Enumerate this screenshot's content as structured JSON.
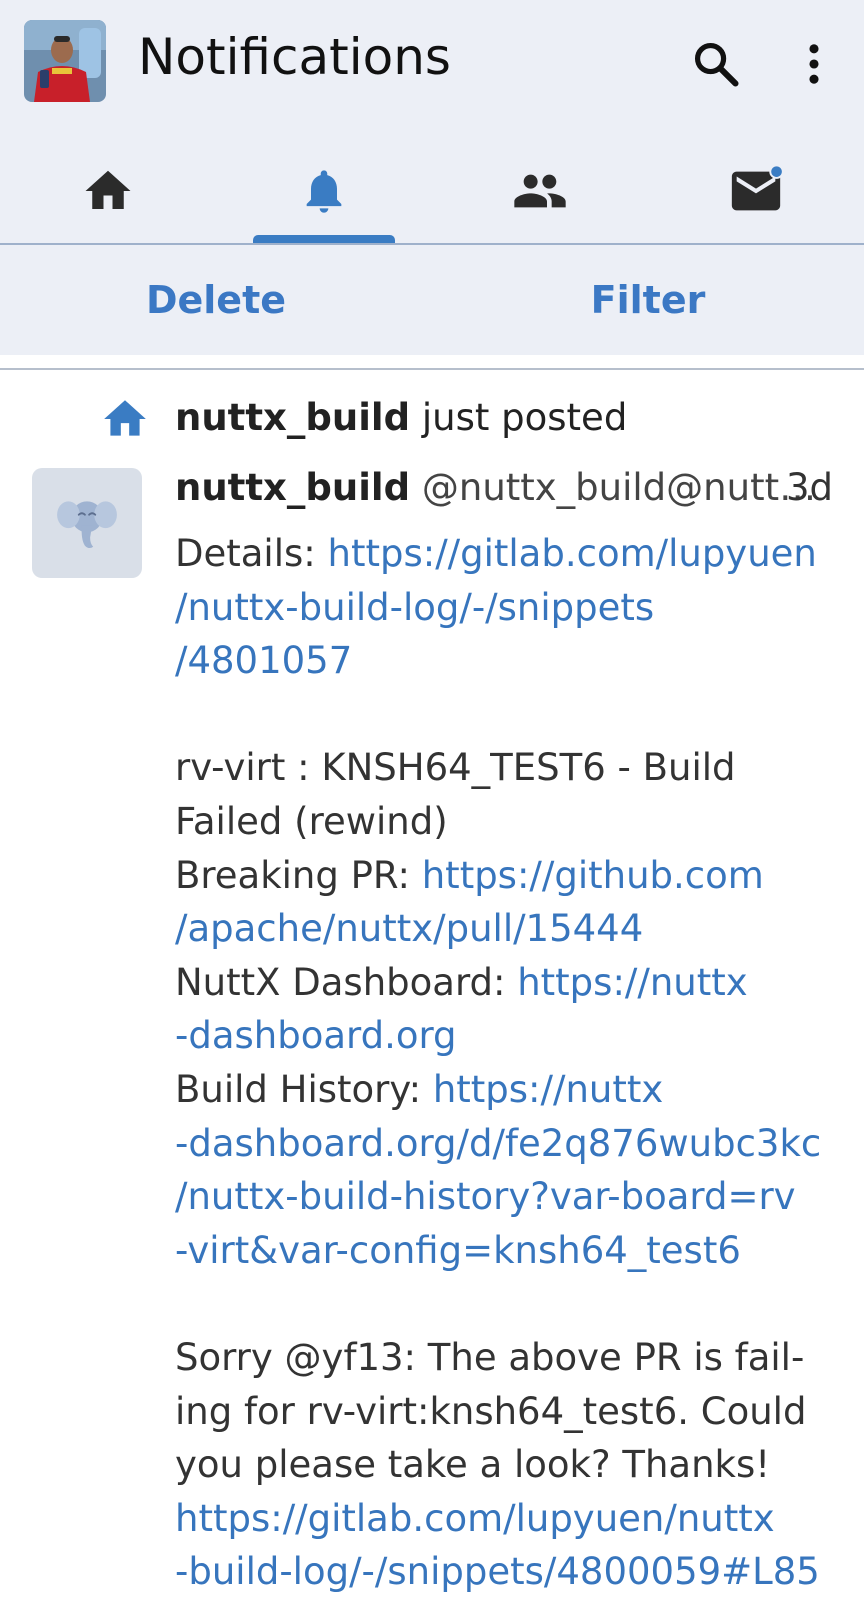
{
  "header": {
    "title": "Notifications",
    "avatar": "profile-photo",
    "search_icon": "search-icon",
    "more_icon": "more-vert-icon"
  },
  "tabs": [
    {
      "name": "home",
      "icon": "home-icon",
      "active": false
    },
    {
      "name": "notifications",
      "icon": "bell-icon",
      "active": true
    },
    {
      "name": "people",
      "icon": "people-icon",
      "active": false
    },
    {
      "name": "messages",
      "icon": "mail-icon",
      "active": false,
      "badge": true
    }
  ],
  "actions": {
    "delete_label": "Delete",
    "filter_label": "Filter"
  },
  "notification": {
    "icon": "home-icon",
    "actor": "nuttx_build",
    "verb": "just posted",
    "status": {
      "display_name": "nuttx_build",
      "handle": "@nuttx_build@nutt…",
      "time": "3d",
      "lines": {
        "l1_text": "Details: ",
        "l1_link": "https://gitlab.com/lupyuen",
        "l2_link": "/nuttx-build-log/-/snippets",
        "l3_link": "/4801057",
        "l4_text": "rv-virt : KNSH64_TEST6 - Build",
        "l5_text": "Failed (rewind)",
        "l6_text": "Breaking PR: ",
        "l6_link": "https://github.com",
        "l7_link": "/apache/nuttx/pull/15444",
        "l8_text": "NuttX Dashboard: ",
        "l8_link": "https://nuttx",
        "l9_link": "-dashboard.org",
        "l10_text": "Build History: ",
        "l10_link": "https://nuttx",
        "l11_link": "-dashboard.org/d/fe2q876wubc3kc",
        "l12_link": "/nuttx-build-history?var-board=rv",
        "l13_link": "-virt&var-config=knsh64_test6",
        "l14_text": "Sorry @yf13: The above PR is fail-",
        "l15_text": "ing for rv-virt:knsh64_test6. Could",
        "l16_text": "you please take a look? Thanks!",
        "l17_link": "https://gitlab.com/lupyuen/nuttx",
        "l18_link": "-build-log/-/snippets/4800059#L85"
      }
    }
  },
  "colors": {
    "topbar_bg": "#eceff6",
    "accent": "#3b78c4",
    "link": "#3775bd",
    "icon": "#222222",
    "badge": "#3a7cc3"
  }
}
